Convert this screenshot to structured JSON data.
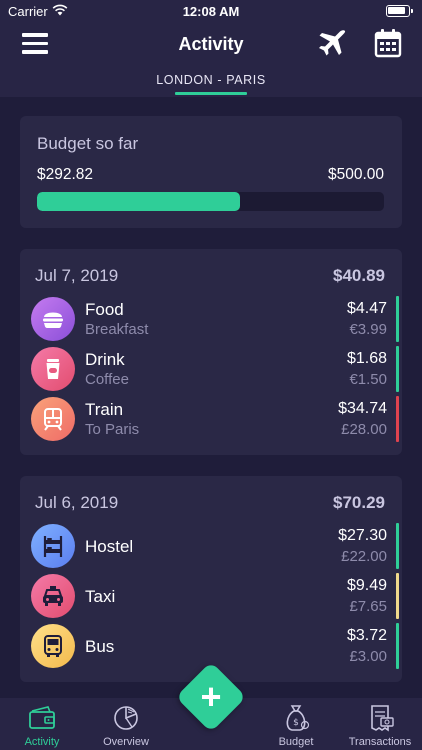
{
  "status": {
    "carrier": "Carrier",
    "time": "12:08 AM"
  },
  "header": {
    "title": "Activity",
    "trip": "LONDON - PARIS"
  },
  "budget": {
    "title": "Budget so far",
    "spent": "$292.82",
    "total": "$500.00",
    "progress": 0.586
  },
  "days": [
    {
      "date": "Jul 7, 2019",
      "total": "$40.89",
      "items": [
        {
          "name": "Food",
          "sub": "Breakfast",
          "amount": "$4.47",
          "local": "€3.99",
          "icon": "burger-icon",
          "bar": "#2fce98"
        },
        {
          "name": "Drink",
          "sub": "Coffee",
          "amount": "$1.68",
          "local": "€1.50",
          "icon": "coffee-cup-icon",
          "bar": "#2fce98"
        },
        {
          "name": "Train",
          "sub": "To Paris",
          "amount": "$34.74",
          "local": "£28.00",
          "icon": "train-icon",
          "bar": "#e0434f"
        }
      ]
    },
    {
      "date": "Jul 6, 2019",
      "total": "$70.29",
      "items": [
        {
          "name": "Hostel",
          "sub": "",
          "amount": "$27.30",
          "local": "£22.00",
          "icon": "bunk-bed-icon",
          "bar": "#2fce98"
        },
        {
          "name": "Taxi",
          "sub": "",
          "amount": "$9.49",
          "local": "£7.65",
          "icon": "taxi-icon",
          "bar": "#f0d98c"
        },
        {
          "name": "Bus",
          "sub": "",
          "amount": "$3.72",
          "local": "£3.00",
          "icon": "bus-icon",
          "bar": "#2fce98"
        }
      ]
    }
  ],
  "tabs": [
    {
      "label": "Activity",
      "icon": "wallet-icon",
      "active": true
    },
    {
      "label": "Overview",
      "icon": "pie-chart-icon",
      "active": false
    },
    {
      "label": "Budget",
      "icon": "money-bag-icon",
      "active": false
    },
    {
      "label": "Transactions",
      "icon": "receipt-icon",
      "active": false
    }
  ],
  "fab": {
    "symbol": "+"
  },
  "colors": {
    "accent": "#2fce98",
    "background": "#1f1d3a",
    "card": "#2a2846",
    "alert": "#e0434f",
    "warning": "#f0d98c"
  }
}
